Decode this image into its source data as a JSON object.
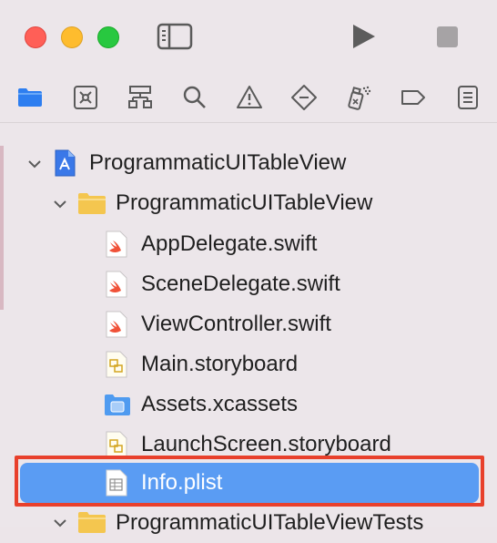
{
  "titlebar": {
    "icons": [
      "close-button",
      "minimize-button",
      "zoom-button",
      "sidebar-icon",
      "play-icon",
      "stop-icon"
    ]
  },
  "navigator": {
    "icons": [
      "folder-icon",
      "source-control-icon",
      "hierarchy-icon",
      "search-icon",
      "warning-icon",
      "test-diamond-icon",
      "debug-spray-icon",
      "breakpoint-tag-icon",
      "report-list-icon"
    ]
  },
  "tree": {
    "project": "ProgrammaticUITableView",
    "group": "ProgrammaticUITableView",
    "files": [
      {
        "name": "AppDelegate.swift",
        "icon": "swift-file-icon"
      },
      {
        "name": "SceneDelegate.swift",
        "icon": "swift-file-icon"
      },
      {
        "name": "ViewController.swift",
        "icon": "swift-file-icon"
      },
      {
        "name": "Main.storyboard",
        "icon": "storyboard-file-icon"
      },
      {
        "name": "Assets.xcassets",
        "icon": "assets-folder-icon"
      },
      {
        "name": "LaunchScreen.storyboard",
        "icon": "storyboard-file-icon"
      },
      {
        "name": "Info.plist",
        "icon": "plist-file-icon"
      }
    ],
    "next_group": "ProgrammaticUITableViewTests"
  },
  "colors": {
    "selection": "#5a9cf3",
    "highlight_border": "#e8402c",
    "folder": "#f4c64f"
  }
}
